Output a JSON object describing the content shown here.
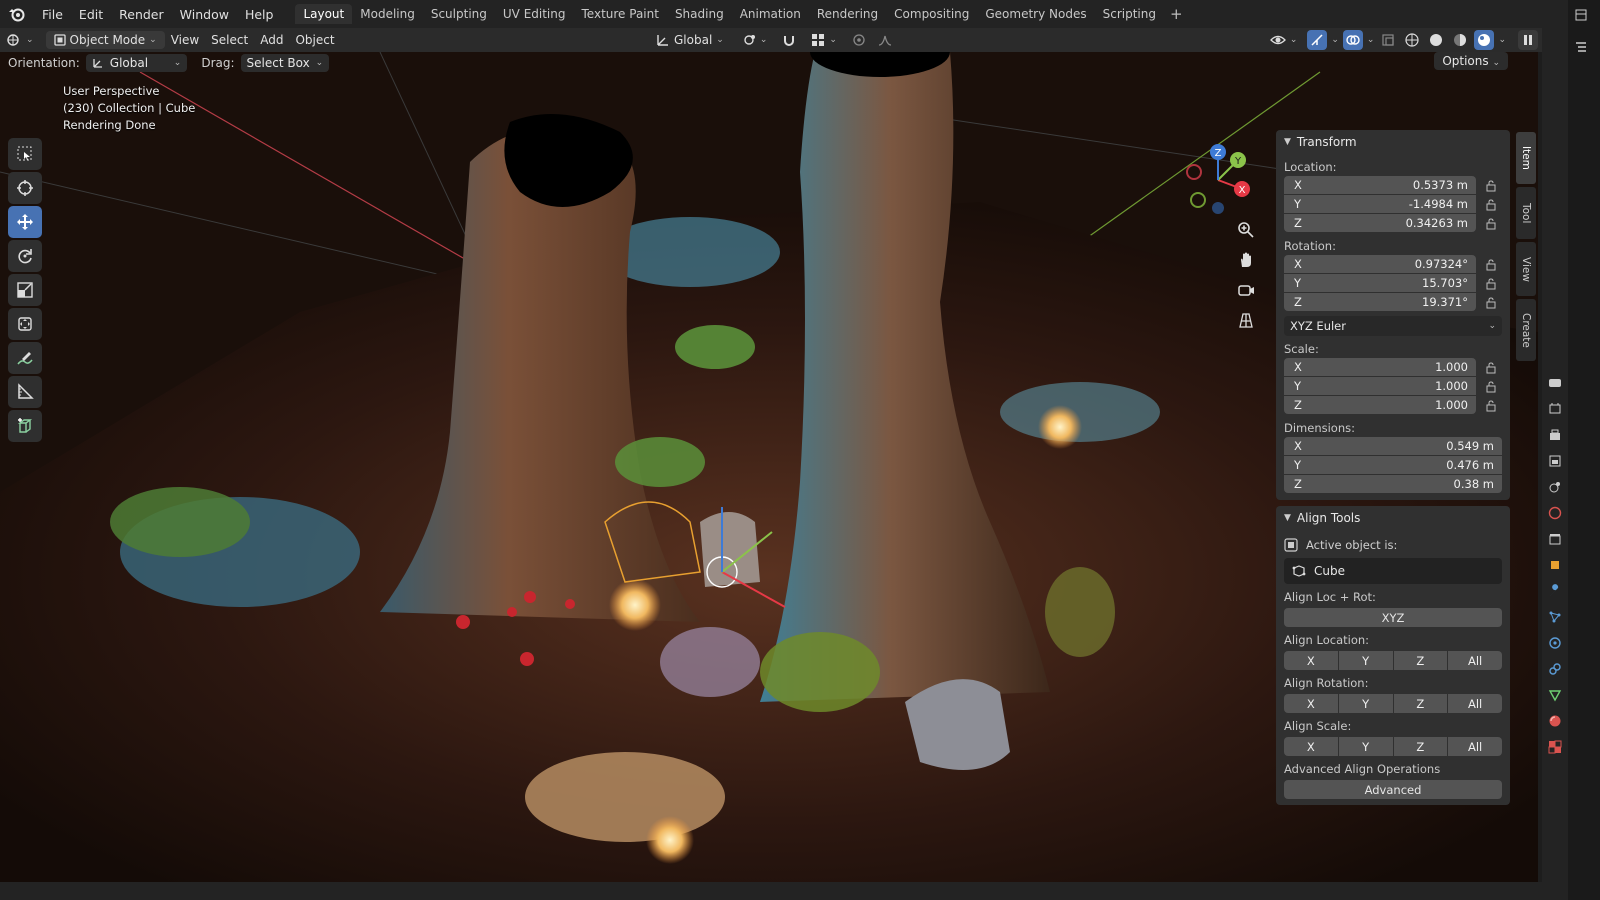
{
  "menubar": {
    "items": [
      "File",
      "Edit",
      "Render",
      "Window",
      "Help"
    ],
    "workspaces": [
      "Layout",
      "Modeling",
      "Sculpting",
      "UV Editing",
      "Texture Paint",
      "Shading",
      "Animation",
      "Rendering",
      "Compositing",
      "Geometry Nodes",
      "Scripting"
    ],
    "active_workspace": "Layout",
    "add_tab": "+"
  },
  "header": {
    "mode": "Object Mode",
    "menus": [
      "View",
      "Select",
      "Add",
      "Object"
    ],
    "transform_orientation": "Global"
  },
  "tool_header": {
    "orientation_label": "Orientation:",
    "orientation_value": "Global",
    "drag_label": "Drag:",
    "drag_value": "Select Box",
    "options": "Options"
  },
  "viewport": {
    "line1": "User Perspective",
    "line2": "(230) Collection | Cube",
    "line3": "Rendering Done",
    "gizmo": {
      "x": "X",
      "y": "Y",
      "z": "Z"
    }
  },
  "transform": {
    "title": "Transform",
    "location_label": "Location:",
    "location": [
      {
        "axis": "X",
        "value": "0.5373 m"
      },
      {
        "axis": "Y",
        "value": "-1.4984 m"
      },
      {
        "axis": "Z",
        "value": "0.34263 m"
      }
    ],
    "rotation_label": "Rotation:",
    "rotation": [
      {
        "axis": "X",
        "value": "0.97324°"
      },
      {
        "axis": "Y",
        "value": "15.703°"
      },
      {
        "axis": "Z",
        "value": "19.371°"
      }
    ],
    "rotation_mode": "XYZ Euler",
    "scale_label": "Scale:",
    "scale": [
      {
        "axis": "X",
        "value": "1.000"
      },
      {
        "axis": "Y",
        "value": "1.000"
      },
      {
        "axis": "Z",
        "value": "1.000"
      }
    ],
    "dimensions_label": "Dimensions:",
    "dimensions": [
      {
        "axis": "X",
        "value": "0.549 m"
      },
      {
        "axis": "Y",
        "value": "0.476 m"
      },
      {
        "axis": "Z",
        "value": "0.38 m"
      }
    ]
  },
  "align_tools": {
    "title": "Align Tools",
    "active_label": "Active object is:",
    "active_object": "Cube",
    "loc_rot_label": "Align Loc + Rot:",
    "loc_rot_button": "XYZ",
    "location_label": "Align Location:",
    "rotation_label": "Align Rotation:",
    "scale_label": "Align Scale:",
    "axis_buttons": [
      "X",
      "Y",
      "Z",
      "All"
    ],
    "advanced_label": "Advanced Align Operations",
    "advanced_button": "Advanced"
  },
  "side_tabs": [
    "Item",
    "Tool",
    "View",
    "Create"
  ],
  "colors": {
    "accent": "#4772b3",
    "x_axis": "#e63946",
    "y_axis": "#8bc34a",
    "z_axis": "#3e7bd6"
  }
}
